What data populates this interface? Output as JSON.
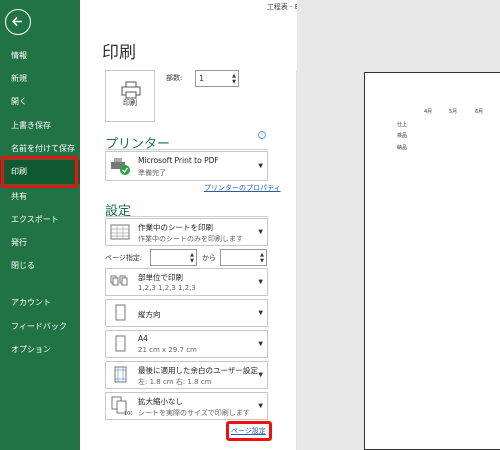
{
  "window": {
    "title": "工程表  -  Excel"
  },
  "colors": {
    "sidebar": "#217346",
    "active": "#0f5a30",
    "highlight": "#e11111",
    "link": "#2b5ea8"
  },
  "sidebar": {
    "back_icon": "arrow-left-icon",
    "items": [
      {
        "label": "情報"
      },
      {
        "label": "新規"
      },
      {
        "label": "開く"
      },
      {
        "label": "上書き保存"
      },
      {
        "label": "名前を付けて保存"
      },
      {
        "label": "印刷",
        "active": true
      },
      {
        "label": "共有"
      },
      {
        "label": "エクスポート"
      },
      {
        "label": "発行"
      },
      {
        "label": "閉じる"
      },
      {
        "label": "アカウント"
      },
      {
        "label": "フィードバック"
      },
      {
        "label": "オプション"
      }
    ]
  },
  "print": {
    "title": "印刷",
    "print_button_label": "印刷",
    "copies_label": "部数:",
    "copies_value": "1"
  },
  "printer": {
    "heading": "プリンター",
    "name": "Microsoft Print to PDF",
    "status": "準備完了",
    "properties_link": "プリンターのプロパティ"
  },
  "settings": {
    "heading": "設定",
    "what": {
      "main": "作業中のシートを印刷",
      "sub": "作業中のシートのみを印刷します"
    },
    "pages_label": "ページ指定:",
    "pages_from": "",
    "pages_to_label": "から",
    "pages_to": "",
    "collate": {
      "main": "部単位で印刷",
      "sub": "1,2,3    1,2,3    1,2,3"
    },
    "orientation": {
      "main": "縦方向"
    },
    "paper": {
      "main": "A4",
      "sub": "21 cm x 29.7 cm"
    },
    "margins": {
      "main": "最後に適用した余白のユーザー設定",
      "sub": "左:  1.8 cm    右:  1.8 cm"
    },
    "scaling": {
      "main": "拡大縮小なし",
      "sub": "シートを実際のサイズで印刷します"
    },
    "page_setup_link": "ページ設定"
  },
  "preview": {
    "months": [
      "4月",
      "5月",
      "6月"
    ],
    "rows": [
      "仕上",
      "検品",
      "納品"
    ]
  }
}
